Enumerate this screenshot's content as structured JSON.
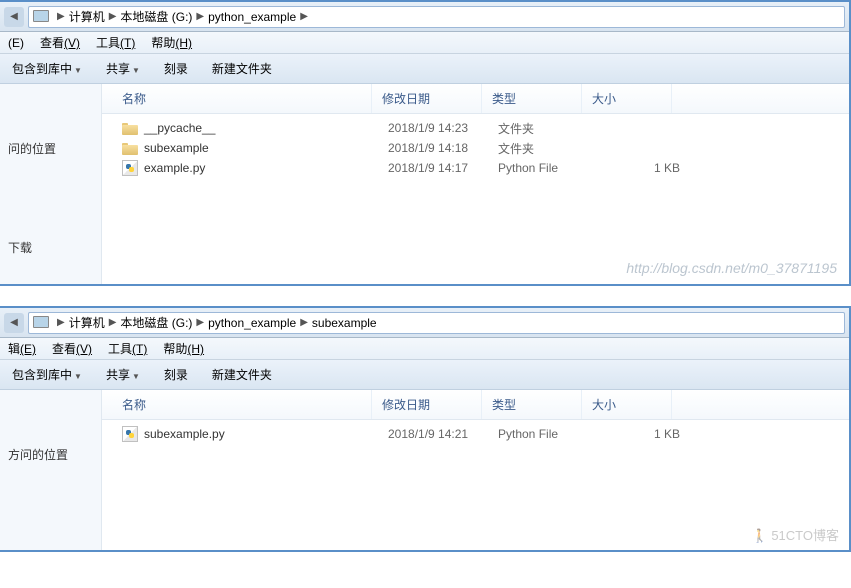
{
  "windows": [
    {
      "breadcrumb": {
        "computer": "计算机",
        "drive": "本地磁盘 (G:)",
        "folder1": "python_example",
        "folder2": ""
      },
      "menu": {
        "edit": "(E)",
        "view_prefix": "查看",
        "view_key": "(V)",
        "tools_prefix": "工具",
        "tools_key": "(T)",
        "help_prefix": "帮助",
        "help_key": "(H)"
      },
      "toolbar": {
        "include": "包含到库中",
        "share": "共享",
        "burn": "刻录",
        "newfolder": "新建文件夹"
      },
      "headers": {
        "name": "名称",
        "date": "修改日期",
        "type": "类型",
        "size": "大小"
      },
      "rows": [
        {
          "name": "__pycache__",
          "date": "2018/1/9 14:23",
          "type": "文件夹",
          "size": "",
          "icon": "folder"
        },
        {
          "name": "subexample",
          "date": "2018/1/9 14:18",
          "type": "文件夹",
          "size": "",
          "icon": "folder"
        },
        {
          "name": "example.py",
          "date": "2018/1/9 14:17",
          "type": "Python File",
          "size": "1 KB",
          "icon": "py"
        }
      ],
      "sidebar": {
        "recent": "问的位置",
        "downloads": "下载"
      },
      "watermark": "http://blog.csdn.net/m0_37871195"
    },
    {
      "breadcrumb": {
        "computer": "计算机",
        "drive": "本地磁盘 (G:)",
        "folder1": "python_example",
        "folder2": "subexample"
      },
      "menu": {
        "edit_prefix": "辑",
        "edit": "(E)",
        "view_prefix": "查看",
        "view_key": "(V)",
        "tools_prefix": "工具",
        "tools_key": "(T)",
        "help_prefix": "帮助",
        "help_key": "(H)"
      },
      "toolbar": {
        "include": "包含到库中",
        "share": "共享",
        "burn": "刻录",
        "newfolder": "新建文件夹"
      },
      "headers": {
        "name": "名称",
        "date": "修改日期",
        "type": "类型",
        "size": "大小"
      },
      "rows": [
        {
          "name": "subexample.py",
          "date": "2018/1/9 14:21",
          "type": "Python File",
          "size": "1 KB",
          "icon": "py"
        }
      ],
      "sidebar": {
        "recent": "方问的位置"
      },
      "watermark2": "🚶 51CTO博客"
    }
  ]
}
